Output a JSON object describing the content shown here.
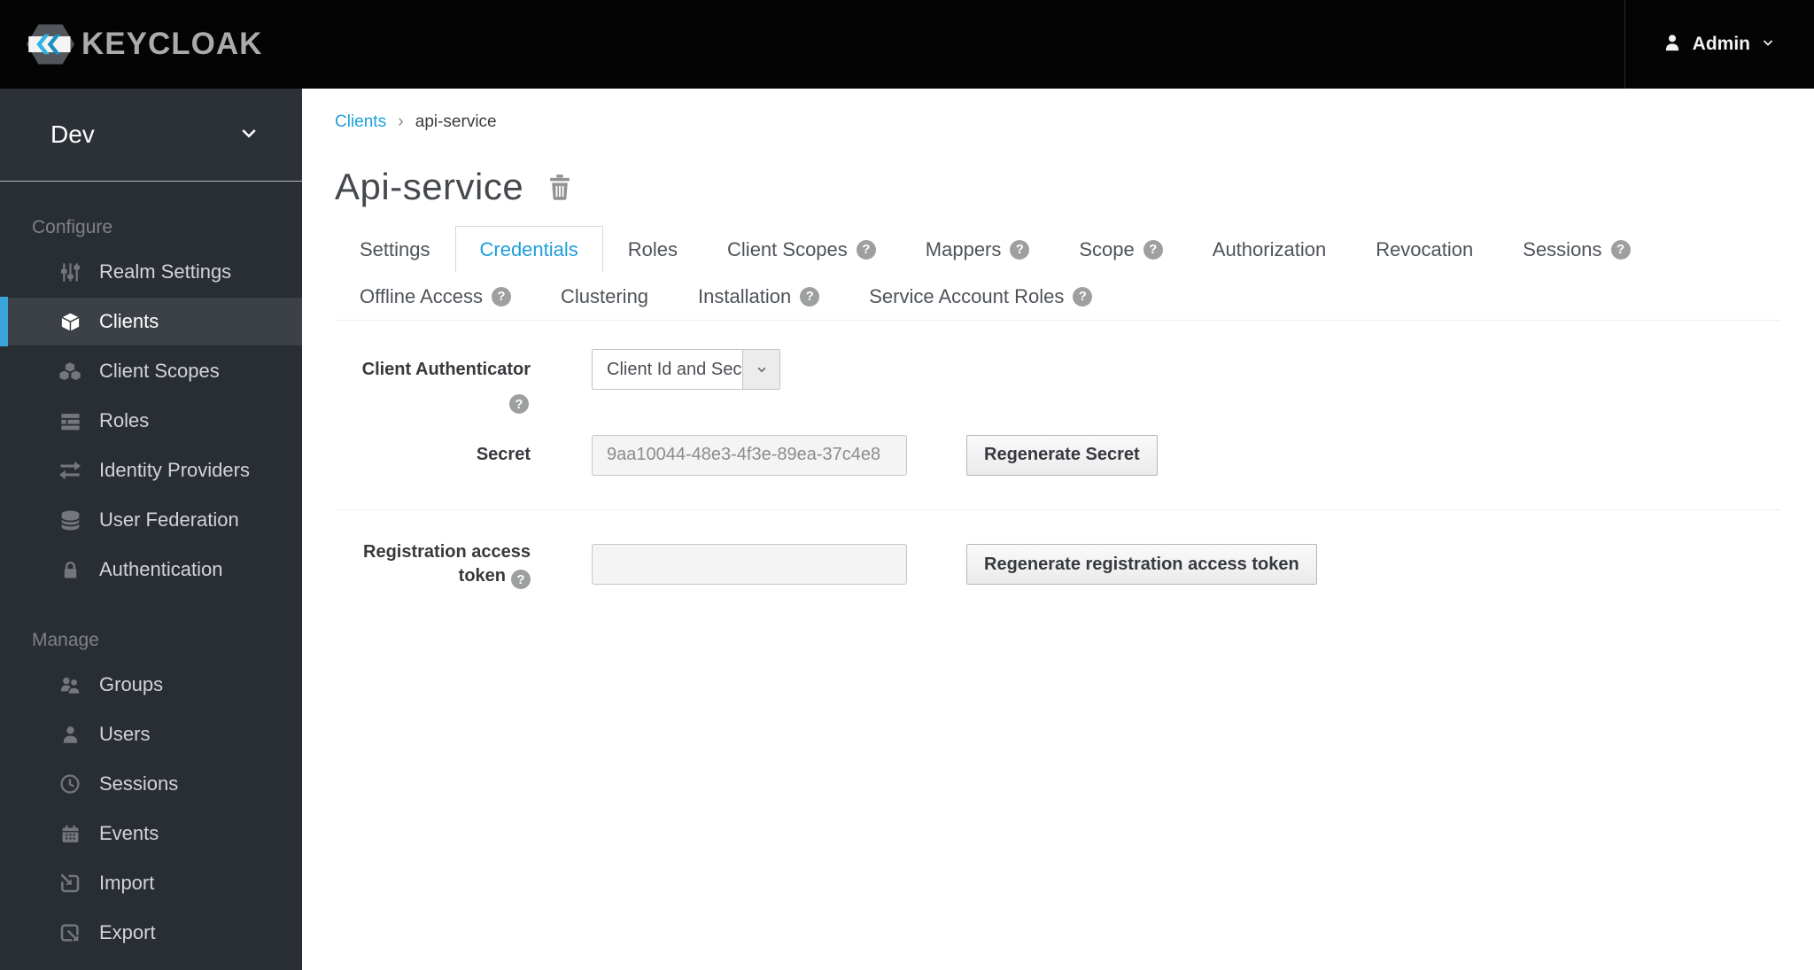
{
  "header": {
    "logo_text": "KEYCLOAK",
    "user_menu": {
      "label": "Admin"
    }
  },
  "sidebar": {
    "realm": {
      "name": "Dev"
    },
    "sections": [
      {
        "label": "Configure",
        "items": [
          {
            "label": "Realm Settings",
            "icon": "sliders-icon",
            "active": false
          },
          {
            "label": "Clients",
            "icon": "cube-icon",
            "active": true
          },
          {
            "label": "Client Scopes",
            "icon": "cubes-icon",
            "active": false
          },
          {
            "label": "Roles",
            "icon": "list-icon",
            "active": false
          },
          {
            "label": "Identity Providers",
            "icon": "exchange-icon",
            "active": false
          },
          {
            "label": "User Federation",
            "icon": "database-icon",
            "active": false
          },
          {
            "label": "Authentication",
            "icon": "lock-icon",
            "active": false
          }
        ]
      },
      {
        "label": "Manage",
        "items": [
          {
            "label": "Groups",
            "icon": "groups-icon",
            "active": false
          },
          {
            "label": "Users",
            "icon": "user-icon",
            "active": false
          },
          {
            "label": "Sessions",
            "icon": "clock-icon",
            "active": false
          },
          {
            "label": "Events",
            "icon": "calendar-icon",
            "active": false
          },
          {
            "label": "Import",
            "icon": "import-icon",
            "active": false
          },
          {
            "label": "Export",
            "icon": "export-icon",
            "active": false
          }
        ]
      }
    ]
  },
  "breadcrumb": {
    "separator": "›",
    "items": [
      {
        "label": "Clients",
        "link": true
      },
      {
        "label": "api-service",
        "link": false
      }
    ]
  },
  "page": {
    "title": "Api-service"
  },
  "tabs": {
    "row1": [
      {
        "label": "Settings",
        "active": false,
        "help": false
      },
      {
        "label": "Credentials",
        "active": true,
        "help": false
      },
      {
        "label": "Roles",
        "active": false,
        "help": false
      },
      {
        "label": "Client Scopes",
        "active": false,
        "help": true
      },
      {
        "label": "Mappers",
        "active": false,
        "help": true
      },
      {
        "label": "Scope",
        "active": false,
        "help": true
      },
      {
        "label": "Authorization",
        "active": false,
        "help": false
      },
      {
        "label": "Revocation",
        "active": false,
        "help": false
      },
      {
        "label": "Sessions",
        "active": false,
        "help": true
      }
    ],
    "row2": [
      {
        "label": "Offline Access",
        "active": false,
        "help": true
      },
      {
        "label": "Clustering",
        "active": false,
        "help": false
      },
      {
        "label": "Installation",
        "active": false,
        "help": true
      },
      {
        "label": "Service Account Roles",
        "active": false,
        "help": true
      }
    ]
  },
  "form": {
    "client_authenticator": {
      "label": "Client Authenticator",
      "value": "Client Id and Secret",
      "help": true
    },
    "secret": {
      "label": "Secret",
      "value": "9aa10044-48e3-4f3e-89ea-37c4e8",
      "button": "Regenerate Secret"
    },
    "registration_token": {
      "label": "Registration access token",
      "value": "",
      "placeholder": "",
      "button": "Regenerate registration access token",
      "help": true
    }
  },
  "icons": {
    "help_glyph": "?"
  },
  "colors": {
    "accent_link": "#1e9fdb",
    "sidebar_bg": "#292e34",
    "sidebar_active_bar": "#39a5dc",
    "header_bg": "#040404"
  }
}
